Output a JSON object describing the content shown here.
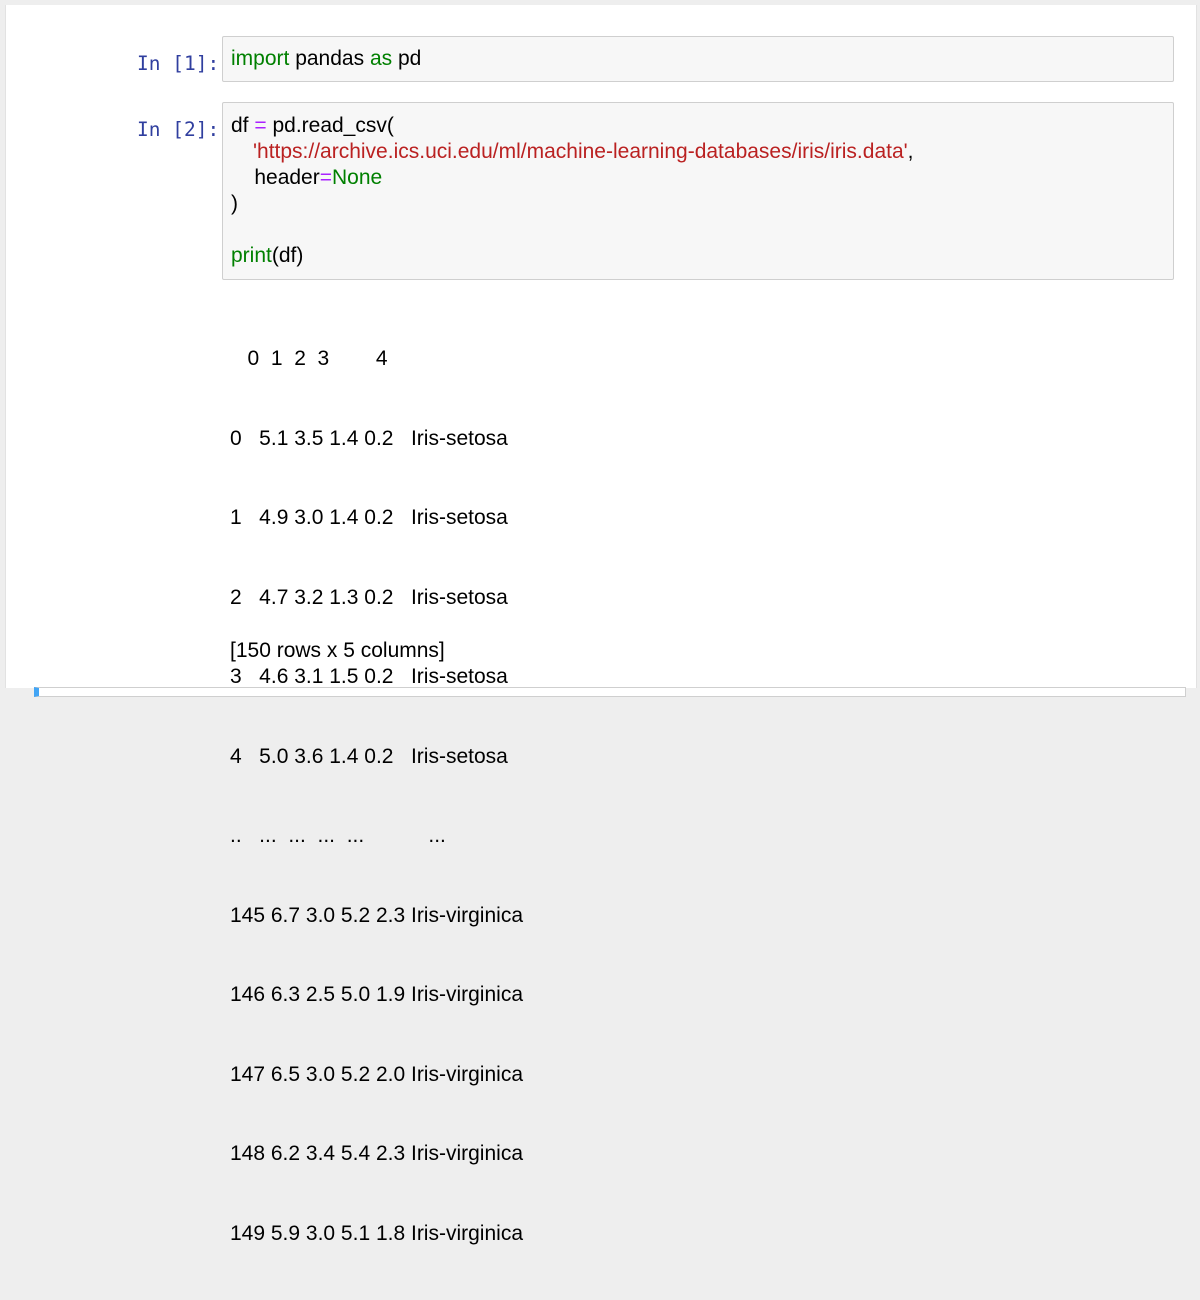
{
  "cells": [
    {
      "prompt": "In [1]:",
      "code": {
        "line1": {
          "kw": "import",
          "rest": " pandas ",
          "kw2": "as",
          "tail": " pd"
        }
      }
    },
    {
      "prompt": "In [2]:",
      "code": {
        "l1_a": "df ",
        "l1_op": "=",
        "l1_b": " pd.read_csv(",
        "l2_str": "'https://archive.ics.uci.edu/ml/machine-learning-databases/iris/iris.data'",
        "l2_comma": ",",
        "l3_a": "    header",
        "l3_op": "=",
        "l3_kw": "None",
        "l4": ")",
        "l5_kw": "print",
        "l5_rest": "(df)"
      },
      "output": {
        "header": "   0  1  2  3        4",
        "rows": [
          "0   5.1 3.5 1.4 0.2   Iris-setosa",
          "1   4.9 3.0 1.4 0.2   Iris-setosa",
          "2   4.7 3.2 1.3 0.2   Iris-setosa",
          "3   4.6 3.1 1.5 0.2   Iris-setosa",
          "4   5.0 3.6 1.4 0.2   Iris-setosa",
          "..   ...  ...  ...  ...           ...",
          "145 6.7 3.0 5.2 2.3 Iris-virginica",
          "146 6.3 2.5 5.0 1.9 Iris-virginica",
          "147 6.5 3.0 5.2 2.0 Iris-virginica",
          "148 6.2 3.4 5.4 2.3 Iris-virginica",
          "149 5.9 3.0 5.1 1.8 Iris-virginica"
        ],
        "summary": "[150 rows x 5 columns]"
      }
    }
  ],
  "colors": {
    "prompt": "#303f9f",
    "keyword": "#008000",
    "string": "#ba2121",
    "operator": "#aa22ff",
    "active_cell_bar": "#42a5f5"
  }
}
